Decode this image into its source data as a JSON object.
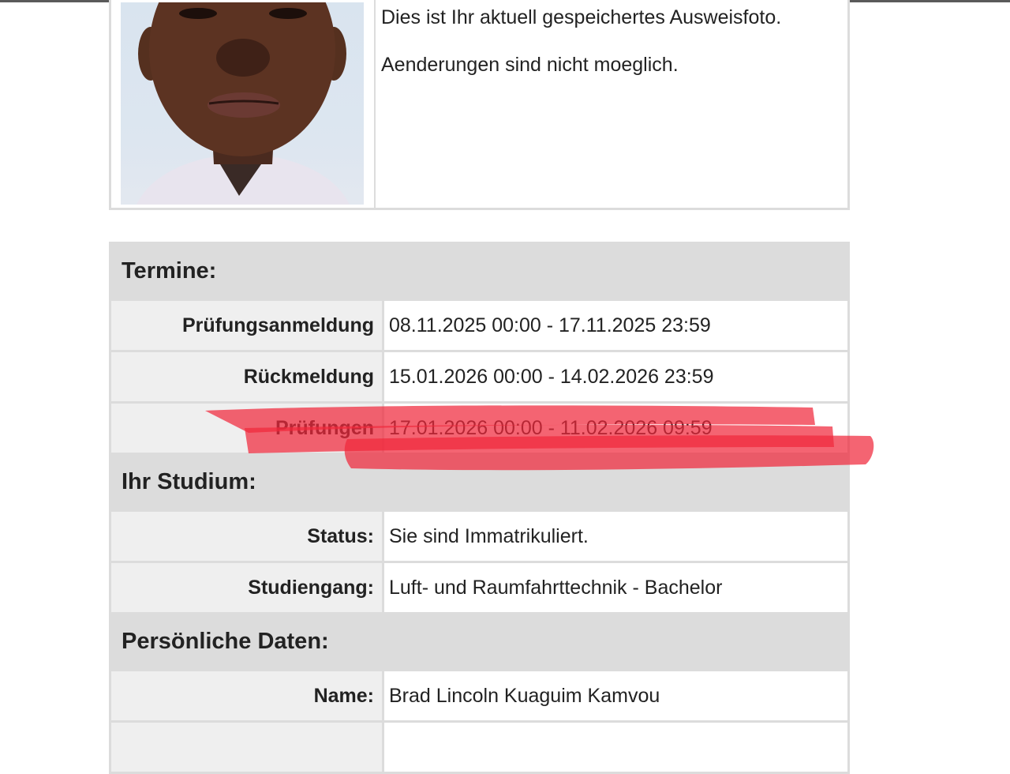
{
  "photo_section": {
    "line1": "Dies ist Ihr aktuell gespeichertes Ausweisfoto.",
    "line2": "Aenderungen sind nicht moeglich."
  },
  "termine": {
    "heading": "Termine:",
    "rows": [
      {
        "label": "Prüfungsanmeldung",
        "value": "08.11.2025 00:00 - 17.11.2025 23:59"
      },
      {
        "label": "Rückmeldung",
        "value": "15.01.2026 00:00 - 14.02.2026 23:59"
      },
      {
        "label": "Prüfungen",
        "value": "17.01.2026 00:00 - 11.02.2026 09:59"
      }
    ]
  },
  "studium": {
    "heading": "Ihr Studium:",
    "rows": [
      {
        "label": "Status:",
        "value": "Sie sind Immatrikuliert."
      },
      {
        "label": "Studiengang:",
        "value": "Luft- und Raumfahrttechnik - Bachelor"
      }
    ]
  },
  "persoenlich": {
    "heading": "Persönliche Daten:",
    "rows": [
      {
        "label": "Name:",
        "value": "Brad Lincoln Kuaguim Kamvou"
      }
    ]
  },
  "colors": {
    "highlight": "#f0283c",
    "header_bg": "#dcdcdc",
    "label_bg": "#efefef"
  }
}
